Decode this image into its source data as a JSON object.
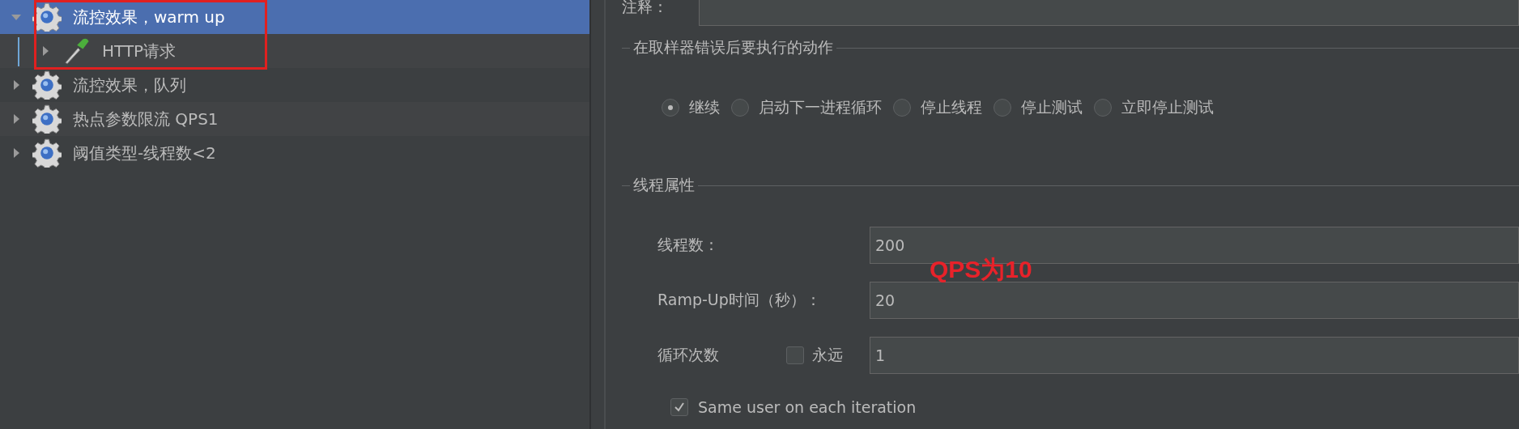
{
  "tree": [
    {
      "label": "流控效果，warm up",
      "kind": "thread-group",
      "selected": true,
      "expanded": true,
      "children": [
        {
          "label": "HTTP请求",
          "kind": "sampler",
          "selected": false,
          "expanded": false
        }
      ]
    },
    {
      "label": "流控效果，队列",
      "kind": "thread-group",
      "selected": false,
      "expanded": false
    },
    {
      "label": "热点参数限流 QPS1",
      "kind": "thread-group",
      "selected": false,
      "expanded": false
    },
    {
      "label": "阈值类型-线程数<2",
      "kind": "thread-group",
      "selected": false,
      "expanded": false
    }
  ],
  "comment": {
    "label": "注释："
  },
  "error_action": {
    "title": "在取样器错误后要执行的动作",
    "options": [
      {
        "label": "继续",
        "selected": true
      },
      {
        "label": "启动下一进程循环",
        "selected": false
      },
      {
        "label": "停止线程",
        "selected": false
      },
      {
        "label": "停止测试",
        "selected": false
      },
      {
        "label": "立即停止测试",
        "selected": false
      }
    ]
  },
  "thread_properties": {
    "title": "线程属性",
    "fields": [
      {
        "label": "线程数：",
        "value": "200"
      },
      {
        "label": "Ramp-Up时间（秒）：",
        "value": "20"
      },
      {
        "label": "循环次数",
        "value": "1",
        "forever": {
          "label": "永远",
          "checked": false
        }
      }
    ],
    "same_user": {
      "label": "Same user on each iteration",
      "checked": true
    }
  },
  "annotation": {
    "text": "QPS为10"
  }
}
